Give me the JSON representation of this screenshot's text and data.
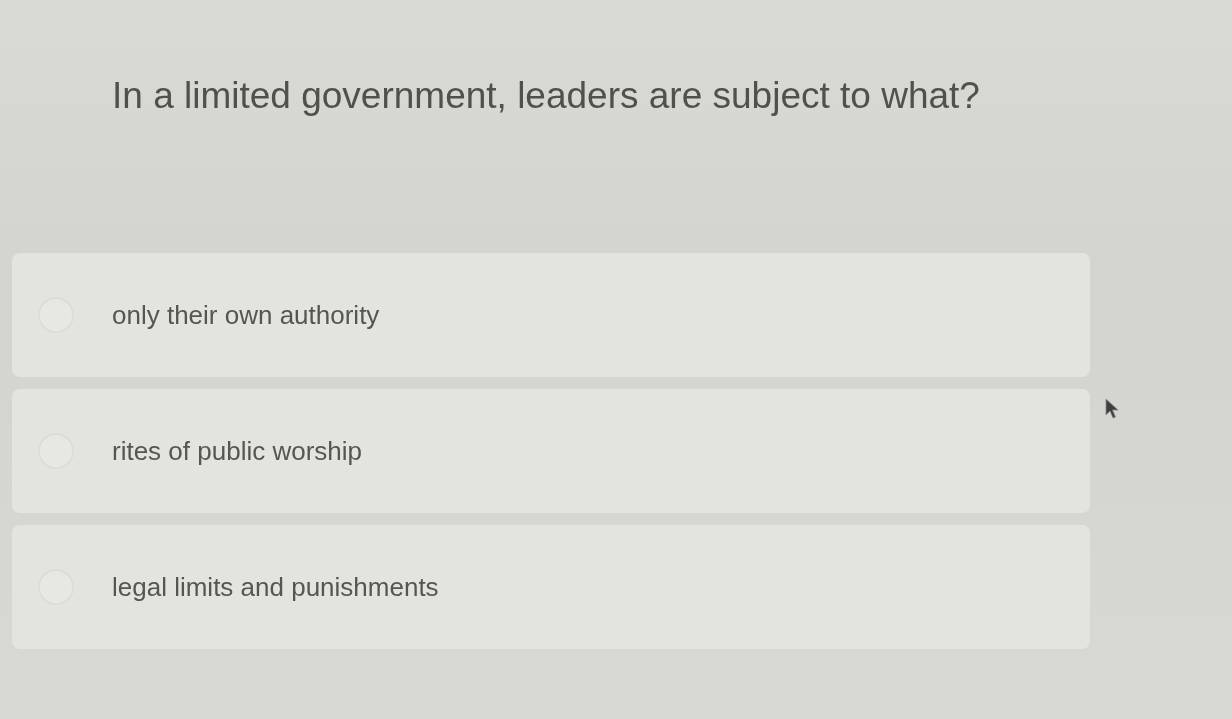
{
  "question": "In a limited government, leaders are subject to what?",
  "options": [
    {
      "label": "only their own authority",
      "selected": false
    },
    {
      "label": "rites of public worship",
      "selected": false
    },
    {
      "label": "legal limits and punishments",
      "selected": false
    }
  ]
}
